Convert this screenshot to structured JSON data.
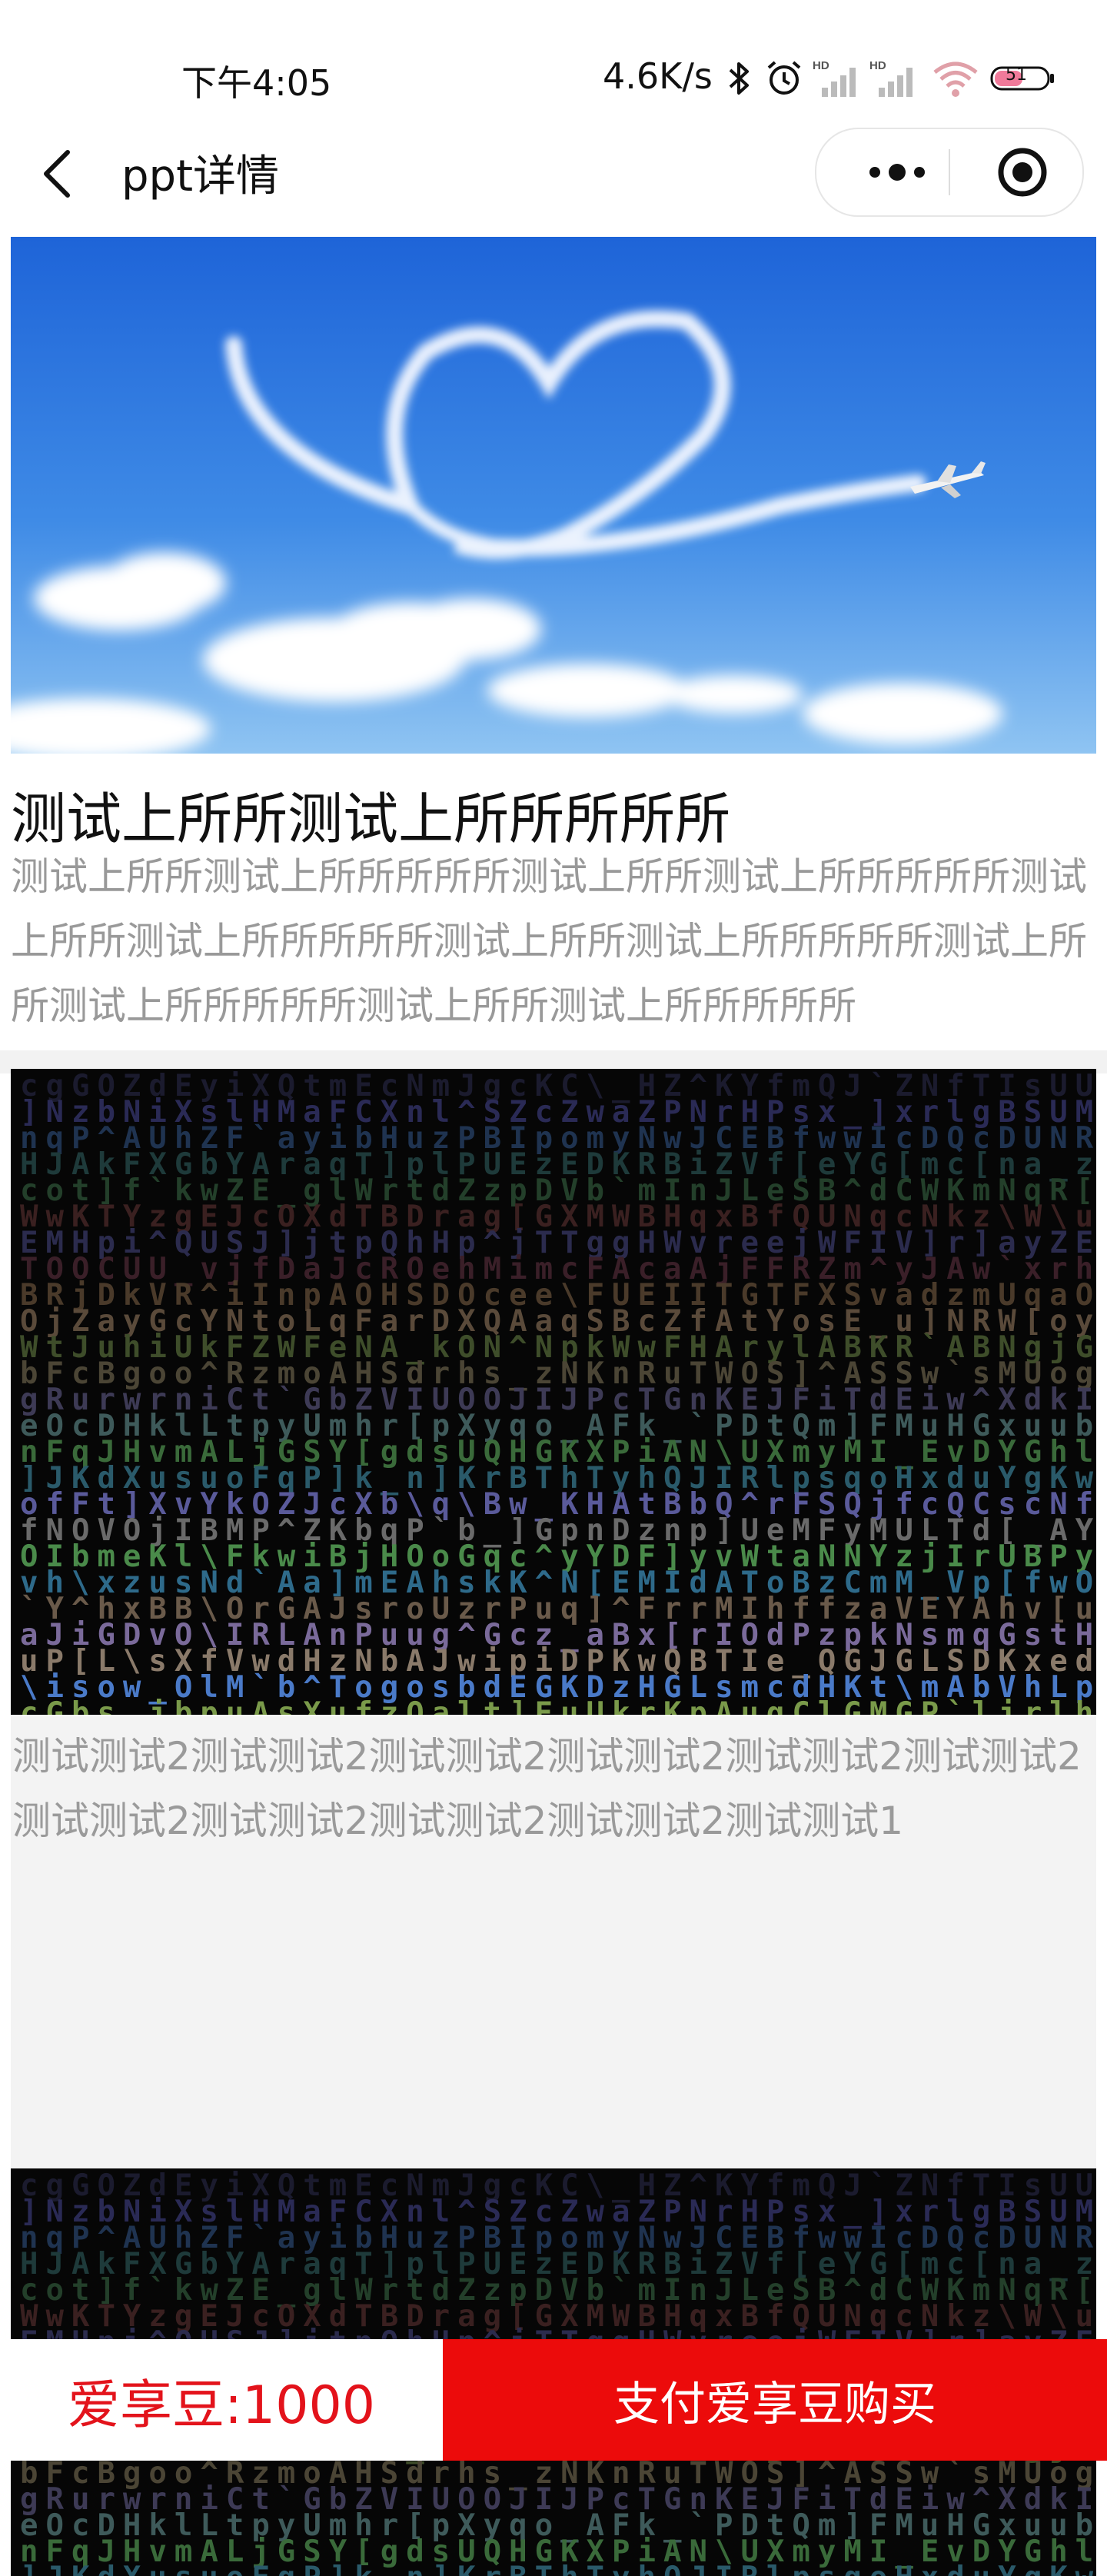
{
  "status_bar": {
    "time": "下午4:05",
    "net_speed": "4.6K/s",
    "battery": "51",
    "icons": [
      "bluetooth-icon",
      "alarm-icon",
      "signal-hd-icon",
      "signal-hd-icon",
      "wifi-icon",
      "battery-icon"
    ]
  },
  "nav": {
    "title": "ppt详情",
    "icons": [
      "back-arrow-icon",
      "more-dots-icon",
      "close-target-icon"
    ]
  },
  "detail": {
    "title": "测试上所所测试上所所所所所",
    "description": "测试上所所测试上所所所所所测试上所所测试上所所所所所测试上所所测试上所所所所所测试上所所测试上所所所所所测试上所所测试上所所所所所测试上所所测试上所所所所所"
  },
  "pages": [
    {
      "caption": "测试测试2测试测试2测试测试2测试测试2测试测试2测试测试2测试测试2测试测试2测试测试2测试测试2测试测试1"
    }
  ],
  "footer": {
    "beans_label": "爱享豆:1000",
    "buy_label": "支付爱享豆购买"
  },
  "colors": {
    "accent": "#ec0b0b",
    "beans_text": "#e3131b",
    "sky_top": "#1e64d8",
    "sky_bottom": "#8fc4f2",
    "muted_text": "#999999"
  }
}
